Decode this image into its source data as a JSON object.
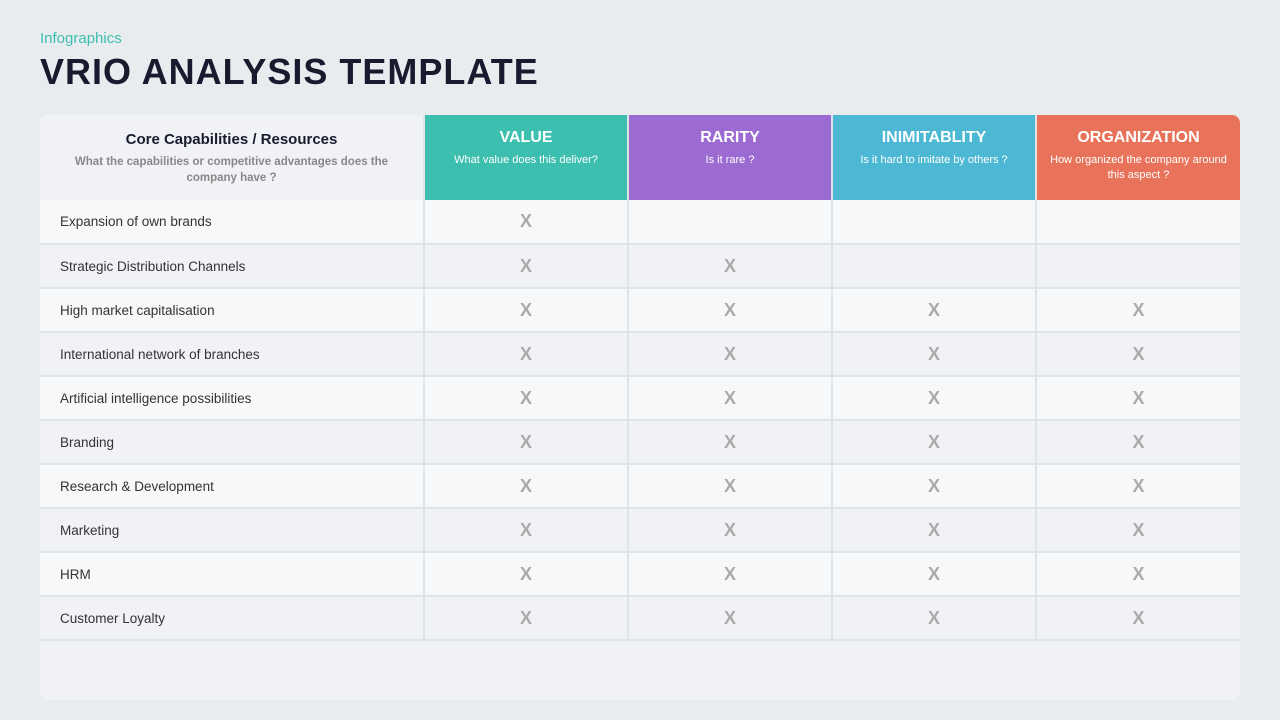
{
  "label": "Infographics",
  "title": "VRIO ANALYSIS TEMPLATE",
  "columns": {
    "capabilities": {
      "title": "Core Capabilities / Resources",
      "subtitle": "What the capabilities or competitive advantages does the company have ?"
    },
    "value": {
      "main": "VALUE",
      "desc": "What value does this deliver?"
    },
    "rarity": {
      "main": "RARITY",
      "desc": "Is it rare ?"
    },
    "inimitability": {
      "main": "INIMITABLITY",
      "desc": "Is it hard to imitate by others ?"
    },
    "organization": {
      "main": "ORGANIZATION",
      "desc": "How organized the company around this aspect ?"
    }
  },
  "rows": [
    {
      "label": "Expansion of own brands",
      "value": true,
      "rarity": false,
      "inimitability": false,
      "organization": false
    },
    {
      "label": "Strategic Distribution Channels",
      "value": true,
      "rarity": true,
      "inimitability": false,
      "organization": false
    },
    {
      "label": "High market capitalisation",
      "value": true,
      "rarity": true,
      "inimitability": true,
      "organization": true
    },
    {
      "label": "International network of branches",
      "value": true,
      "rarity": true,
      "inimitability": true,
      "organization": true
    },
    {
      "label": "Artificial intelligence possibilities",
      "value": true,
      "rarity": true,
      "inimitability": true,
      "organization": true
    },
    {
      "label": "Branding",
      "value": true,
      "rarity": true,
      "inimitability": true,
      "organization": true
    },
    {
      "label": "Research & Development",
      "value": true,
      "rarity": true,
      "inimitability": true,
      "organization": true
    },
    {
      "label": "Marketing",
      "value": true,
      "rarity": true,
      "inimitability": true,
      "organization": true
    },
    {
      "label": "HRM",
      "value": true,
      "rarity": true,
      "inimitability": true,
      "organization": true
    },
    {
      "label": "Customer Loyalty",
      "value": true,
      "rarity": true,
      "inimitability": true,
      "organization": true
    }
  ],
  "x_symbol": "X"
}
